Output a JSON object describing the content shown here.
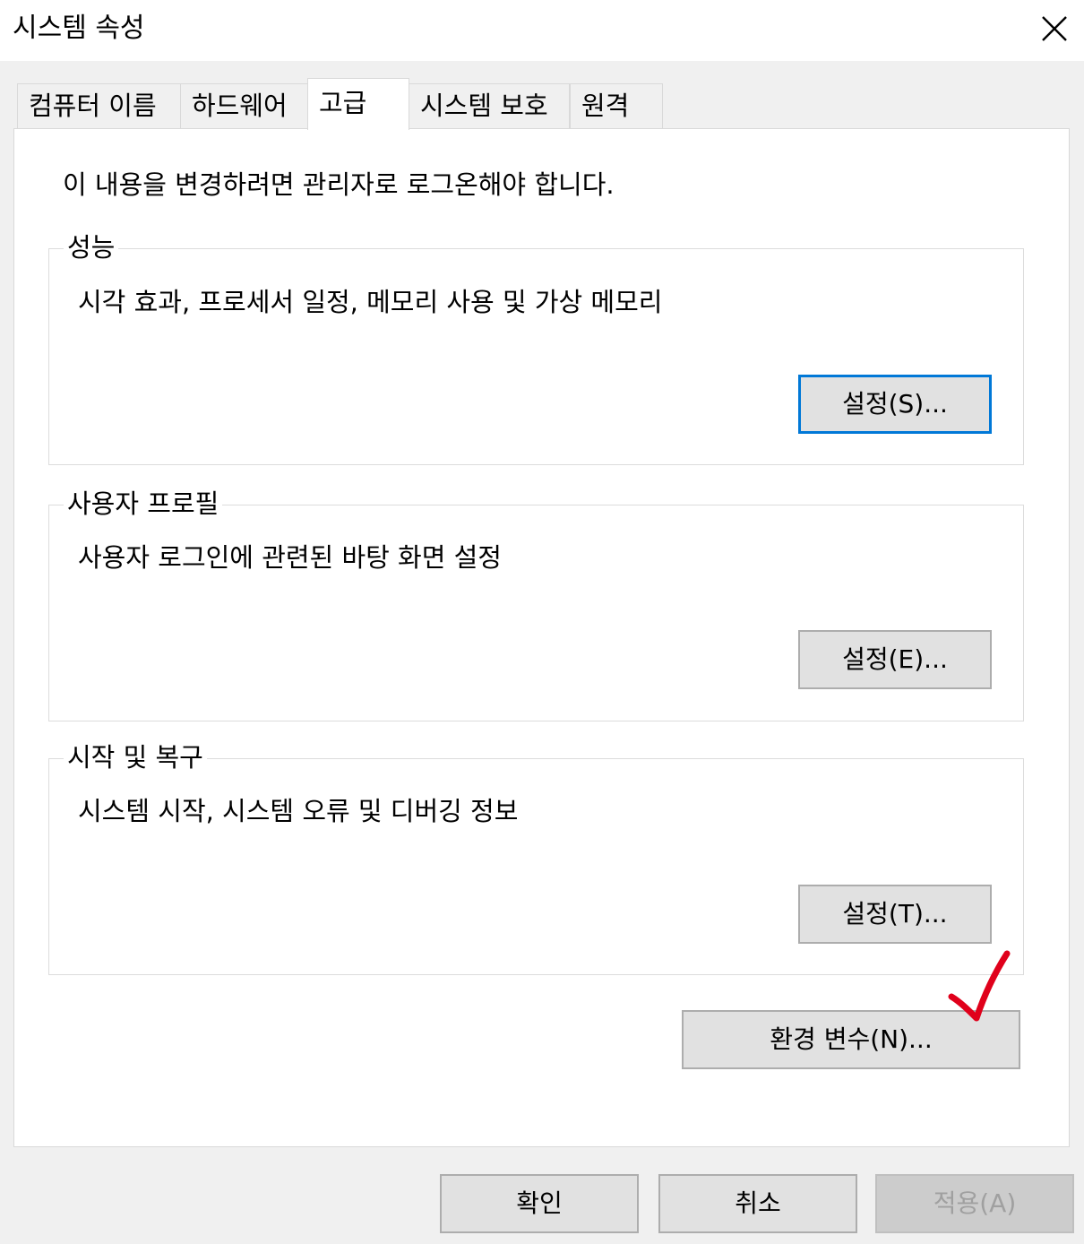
{
  "window": {
    "title": "시스템 속성",
    "close_icon": "close-icon"
  },
  "tabs": [
    {
      "label": "컴퓨터 이름",
      "active": false
    },
    {
      "label": "하드웨어",
      "active": false
    },
    {
      "label": "고급",
      "active": true
    },
    {
      "label": "시스템 보호",
      "active": false
    },
    {
      "label": "원격",
      "active": false
    }
  ],
  "notice": "이 내용을 변경하려면 관리자로 로그온해야 합니다.",
  "groups": {
    "performance": {
      "legend": "성능",
      "description": "시각 효과, 프로세서 일정, 메모리 사용 및 가상 메모리",
      "button": "설정(S)..."
    },
    "user_profiles": {
      "legend": "사용자 프로필",
      "description": "사용자 로그인에 관련된 바탕 화면 설정",
      "button": "설정(E)..."
    },
    "startup_recovery": {
      "legend": "시작 및 복구",
      "description": "시스템 시작, 시스템 오류 및 디버깅 정보",
      "button": "설정(T)..."
    }
  },
  "env_button": "환경 변수(N)...",
  "footer": {
    "ok": "확인",
    "cancel": "취소",
    "apply": "적용(A)",
    "apply_enabled": false
  },
  "annotation": {
    "icon": "checkmark-icon",
    "color": "#e0001b"
  },
  "colors": {
    "focus_border": "#0078d7",
    "button_bg": "#e1e1e1",
    "panel_bg": "#ffffff",
    "dialog_bg": "#f0f0f0"
  }
}
